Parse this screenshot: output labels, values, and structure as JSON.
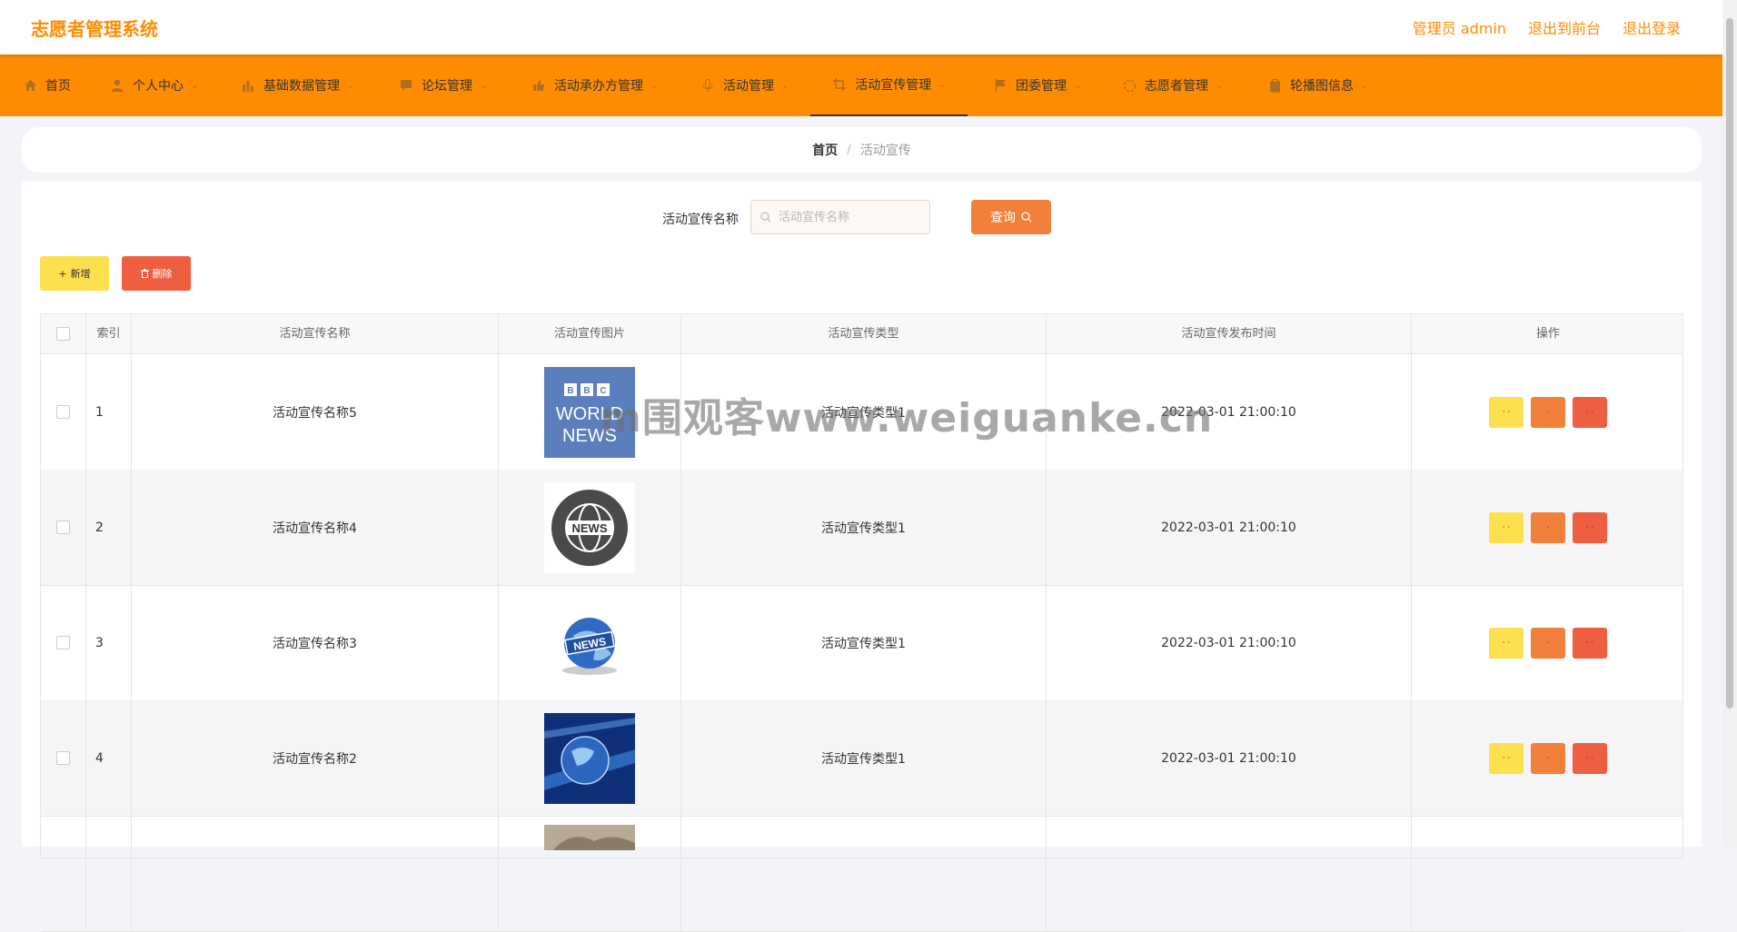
{
  "app": {
    "title": "志愿者管理系统"
  },
  "header": {
    "links": [
      "管理员 admin",
      "退出到前台",
      "退出登录"
    ]
  },
  "nav": {
    "items": [
      {
        "label": "首页",
        "icon": "home-icon",
        "caret": false
      },
      {
        "label": "个人中心",
        "icon": "user-icon",
        "caret": true
      },
      {
        "label": "基础数据管理",
        "icon": "bar-chart-icon",
        "caret": true
      },
      {
        "label": "论坛管理",
        "icon": "chat-icon",
        "caret": true
      },
      {
        "label": "活动承办方管理",
        "icon": "thumb-up-icon",
        "caret": true
      },
      {
        "label": "活动管理",
        "icon": "mic-icon",
        "caret": true
      },
      {
        "label": "活动宣传管理",
        "icon": "crop-icon",
        "caret": true,
        "active": true
      },
      {
        "label": "团委管理",
        "icon": "flag-icon",
        "caret": true
      },
      {
        "label": "志愿者管理",
        "icon": "loading-icon",
        "caret": true
      },
      {
        "label": "轮播图信息",
        "icon": "clipboard-icon",
        "caret": true
      }
    ]
  },
  "breadcrumb": {
    "home": "首页",
    "separator": "/",
    "current": "活动宣传"
  },
  "search": {
    "label": "活动宣传名称",
    "placeholder": "活动宣传名称",
    "button": "查询"
  },
  "toolbar": {
    "add_label": "新增",
    "delete_label": "删除"
  },
  "table": {
    "columns": [
      "索引",
      "活动宣传名称",
      "活动宣传图片",
      "活动宣传类型",
      "活动宣传发布时间",
      "操作"
    ],
    "rows": [
      {
        "index": "1",
        "name": "活动宣传名称5",
        "image": "bbc-world-news-image",
        "type": "活动宣传类型1",
        "time": "2022-03-01 21:00:10"
      },
      {
        "index": "2",
        "name": "活动宣传名称4",
        "image": "news-globe-badge-image",
        "type": "活动宣传类型1",
        "time": "2022-03-01 21:00:10"
      },
      {
        "index": "3",
        "name": "活动宣传名称3",
        "image": "news-globe-3d-image",
        "type": "活动宣传类型1",
        "time": "2022-03-01 21:00:10"
      },
      {
        "index": "4",
        "name": "活动宣传名称2",
        "image": "blue-globe-studio-image",
        "type": "活动宣传类型1",
        "time": "2022-03-01 21:00:10"
      }
    ],
    "row_ops": [
      "· ·",
      "·",
      "· ·"
    ]
  },
  "watermark": "m围观客www.weiguanke.cn",
  "colors": {
    "brand": "#ff8c00",
    "primary_btn": "#f0803a",
    "add_btn": "#fce04d",
    "danger_btn": "#ee5f42"
  }
}
